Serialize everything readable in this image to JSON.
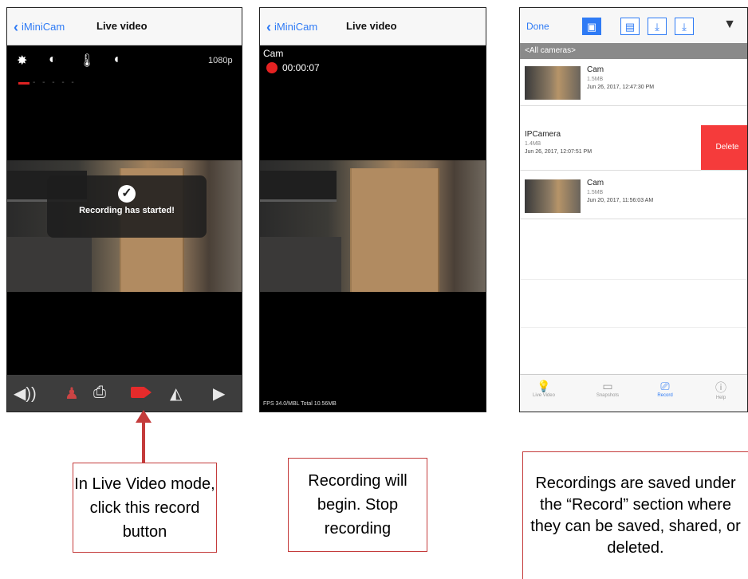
{
  "phone1": {
    "back_label": "iMiniCam",
    "title": "Live video",
    "resolution": "1080p",
    "toast": "Recording has started!",
    "icons": [
      "brightness-icon",
      "contrast-icon",
      "temperature-icon",
      "night-mode-icon"
    ],
    "toolbar_icons": [
      "speaker-icon",
      "mic-icon",
      "snapshot-icon",
      "record-icon",
      "flip-vertical-icon",
      "flip-horizontal-icon"
    ]
  },
  "phone2": {
    "back_label": "iMiniCam",
    "title": "Live video",
    "camera_name": "Cam",
    "timer": "00:00:07",
    "stats": "FPS 34.0/MBL Total 10.56MB"
  },
  "phone3": {
    "done_label": "Done",
    "all_cameras": "<All cameras>",
    "recordings": [
      {
        "title": "Cam",
        "size": "1.5MB",
        "date": "Jun 26, 2017, 12:47:30 PM"
      },
      {
        "title": "IPCamera",
        "size": "1.4MB",
        "date": "Jun 26, 2017, 12:07:51 PM",
        "action": "Delete"
      },
      {
        "title": "Cam",
        "size": "1.5MB",
        "date": "Jun 20, 2017, 11:56:03 AM"
      }
    ],
    "tabs": [
      {
        "label": "Live Video",
        "icon": "bulb-icon"
      },
      {
        "label": "Snapshots",
        "icon": "image-icon"
      },
      {
        "label": "Record",
        "icon": "camera-icon"
      },
      {
        "label": "Help",
        "icon": "info-icon"
      }
    ]
  },
  "callouts": {
    "c1": "In Live Video mode, click this record button",
    "c2": "Recording will begin. Stop recording",
    "c3": "Recordings are saved under the “Record” section where they can be saved, shared, or deleted."
  }
}
